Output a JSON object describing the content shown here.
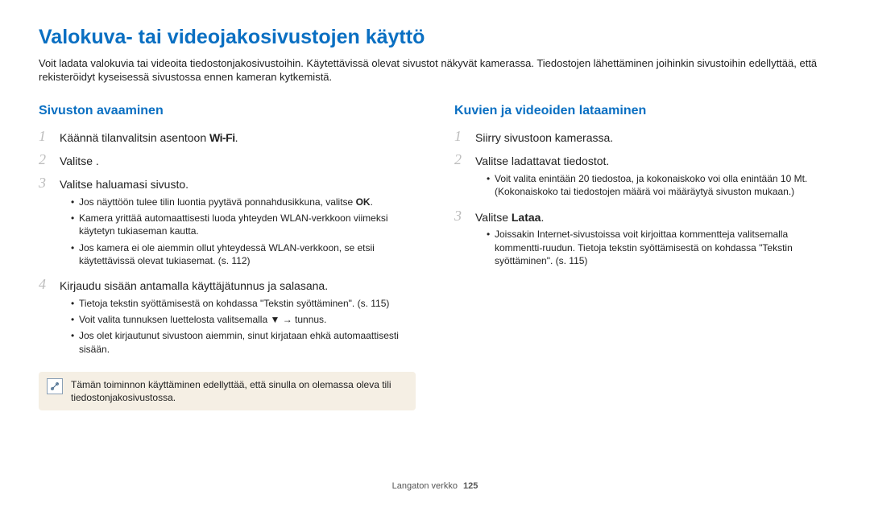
{
  "title": "Valokuva- tai videojakosivustojen käyttö",
  "intro": "Voit ladata valokuvia tai videoita tiedostonjakosivustoihin. Käytettävissä olevat sivustot näkyvät kamerassa. Tiedostojen lähettäminen joihinkin sivustoihin edellyttää, että rekisteröidyt kyseisessä sivustossa ennen kameran kytkemistä.",
  "left": {
    "heading": "Sivuston avaaminen",
    "step1": {
      "num": "1",
      "text_pre": "Käännä tilanvalitsin asentoon ",
      "wifi": "Wi-Fi",
      "text_post": "."
    },
    "step2": {
      "num": "2",
      "text_pre": "Valitse ",
      "text_post": "."
    },
    "step3": {
      "num": "3",
      "main": "Valitse haluamasi sivusto.",
      "b1_pre": "Jos näyttöön tulee tilin luontia pyytävä ponnahdusikkuna, valitse ",
      "b1_bold": "OK",
      "b1_post": ".",
      "b2": "Kamera yrittää automaattisesti luoda yhteyden WLAN-verkkoon viimeksi käytetyn tukiaseman kautta.",
      "b3": "Jos kamera ei ole aiemmin ollut yhteydessä WLAN-verkkoon, se etsii käytettävissä olevat tukiasemat. (s. 112)"
    },
    "step4": {
      "num": "4",
      "main": "Kirjaudu sisään antamalla käyttäjätunnus ja salasana.",
      "b1": "Tietoja tekstin syöttämisestä on kohdassa \"Tekstin syöttäminen\". (s. 115)",
      "b2_pre": "Voit valita tunnuksen luettelosta valitsemalla ",
      "b2_arrow": "▼",
      "b2_mid": " → ",
      "b2_post": "tunnus.",
      "b3": "Jos olet kirjautunut sivustoon aiemmin, sinut kirjataan ehkä automaattisesti sisään."
    },
    "note": "Tämän toiminnon käyttäminen edellyttää, että sinulla on olemassa oleva tili tiedostonjakosivustossa."
  },
  "right": {
    "heading": "Kuvien ja videoiden lataaminen",
    "step1": {
      "num": "1",
      "main": "Siirry sivustoon kamerassa."
    },
    "step2": {
      "num": "2",
      "main": "Valitse ladattavat tiedostot.",
      "b1": "Voit valita enintään 20 tiedostoa, ja kokonaiskoko voi olla enintään 10 Mt. (Kokonaiskoko tai tiedostojen määrä voi määräytyä sivuston mukaan.)"
    },
    "step3": {
      "num": "3",
      "main_pre": "Valitse ",
      "main_bold": "Lataa",
      "main_post": ".",
      "b1": "Joissakin Internet-sivustoissa voit kirjoittaa kommentteja valitsemalla kommentti-ruudun. Tietoja tekstin syöttämisestä on kohdassa \"Tekstin syöttäminen\". (s. 115)"
    }
  },
  "footer": {
    "section": "Langaton verkko",
    "page": "125"
  }
}
